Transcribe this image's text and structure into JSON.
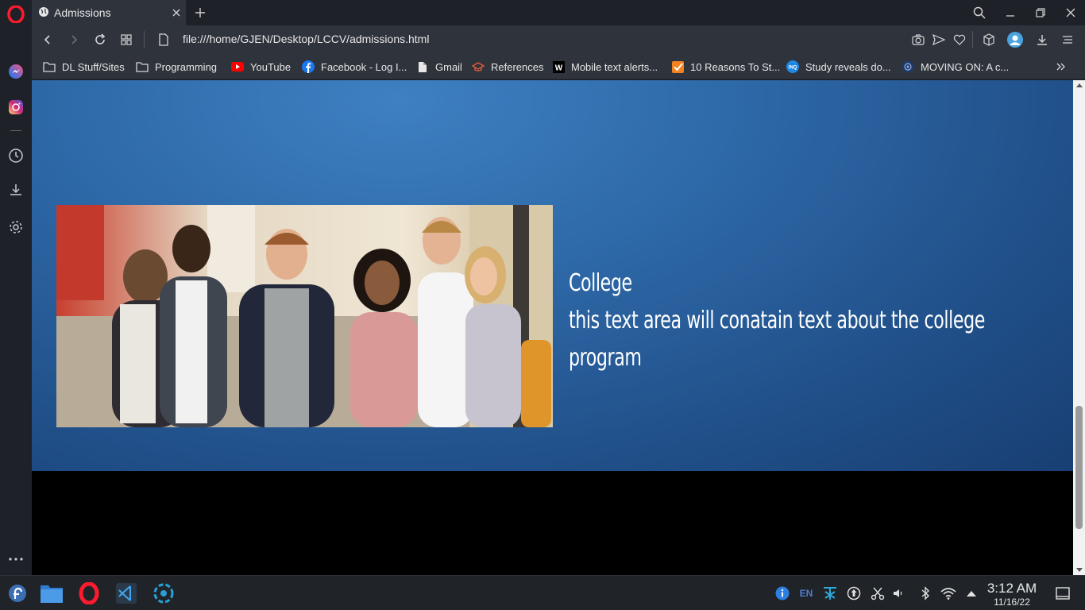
{
  "browser": {
    "tab": {
      "title": "Admissions"
    },
    "url": "file:///home/GJEN/Desktop/LCCV/admissions.html",
    "bookmarks": [
      {
        "label": "DL Stuff/Sites",
        "icon": "folder-icon"
      },
      {
        "label": "Programming",
        "icon": "folder-icon"
      },
      {
        "label": "YouTube",
        "icon": "youtube-icon"
      },
      {
        "label": "Facebook - Log I...",
        "icon": "facebook-icon"
      },
      {
        "label": "Gmail",
        "icon": "page-icon"
      },
      {
        "label": "References",
        "icon": "graduation-cap-icon"
      },
      {
        "label": "Mobile text alerts...",
        "icon": "w-logo-icon"
      },
      {
        "label": "10 Reasons To St...",
        "icon": "checkbox-icon"
      },
      {
        "label": "Study reveals do...",
        "icon": "circle-logo-icon"
      },
      {
        "label": "MOVING ON: A c...",
        "icon": "seal-icon"
      }
    ]
  },
  "page": {
    "section_title": "College",
    "section_body": "this text area will conatain text about the college program"
  },
  "taskbar": {
    "language": "EN",
    "time": "3:12 AM",
    "date": "11/16/22"
  },
  "colors": {
    "opera_red": "#ff1b2d",
    "hero_blue": "#2e69a8",
    "browser_chrome": "#2f333c"
  }
}
